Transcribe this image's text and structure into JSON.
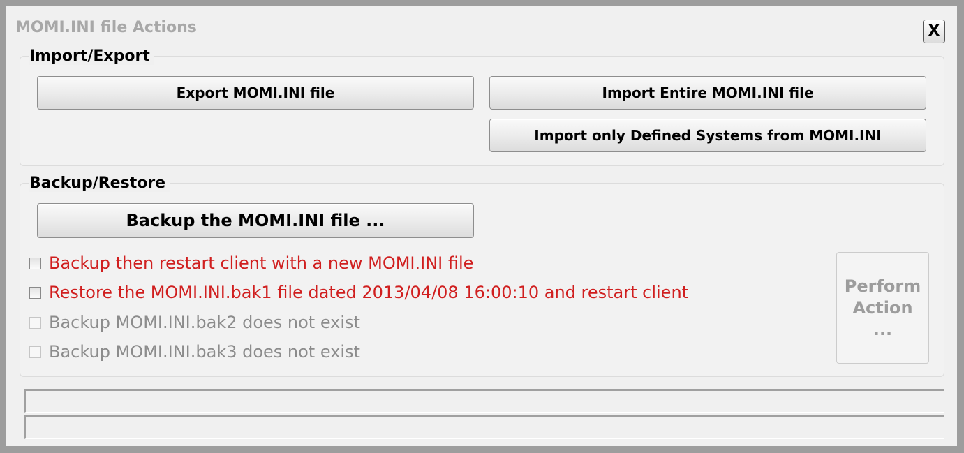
{
  "dialog": {
    "title": "MOMI.INI file Actions",
    "close_label": "X"
  },
  "import_export": {
    "title": "Import/Export",
    "export_label": "Export MOMI.INI file",
    "import_entire_label": "Import Entire MOMI.INI file",
    "import_defined_label": "Import only Defined Systems from MOMI.INI"
  },
  "backup_restore": {
    "title": "Backup/Restore",
    "backup_label": "Backup the MOMI.INI file ...",
    "options": [
      {
        "label": "Backup then restart client with a new MOMI.INI file",
        "checked": false,
        "enabled": true
      },
      {
        "label": "Restore the MOMI.INI.bak1 file dated 2013/04/08 16:00:10 and restart client",
        "checked": false,
        "enabled": true
      },
      {
        "label": "Backup MOMI.INI.bak2 does not exist",
        "checked": false,
        "enabled": false
      },
      {
        "label": "Backup MOMI.INI.bak3 does not exist",
        "checked": false,
        "enabled": false
      }
    ],
    "perform": {
      "line1": "Perform",
      "line2": "Action",
      "line3": "..."
    }
  },
  "status": {
    "line1": "",
    "line2": ""
  },
  "colors": {
    "enabled_option_text": "#d01f1f",
    "disabled_option_text": "#8c8c8c",
    "frame": "#9d9d9d",
    "dialog_bg": "#f0f0f0"
  }
}
